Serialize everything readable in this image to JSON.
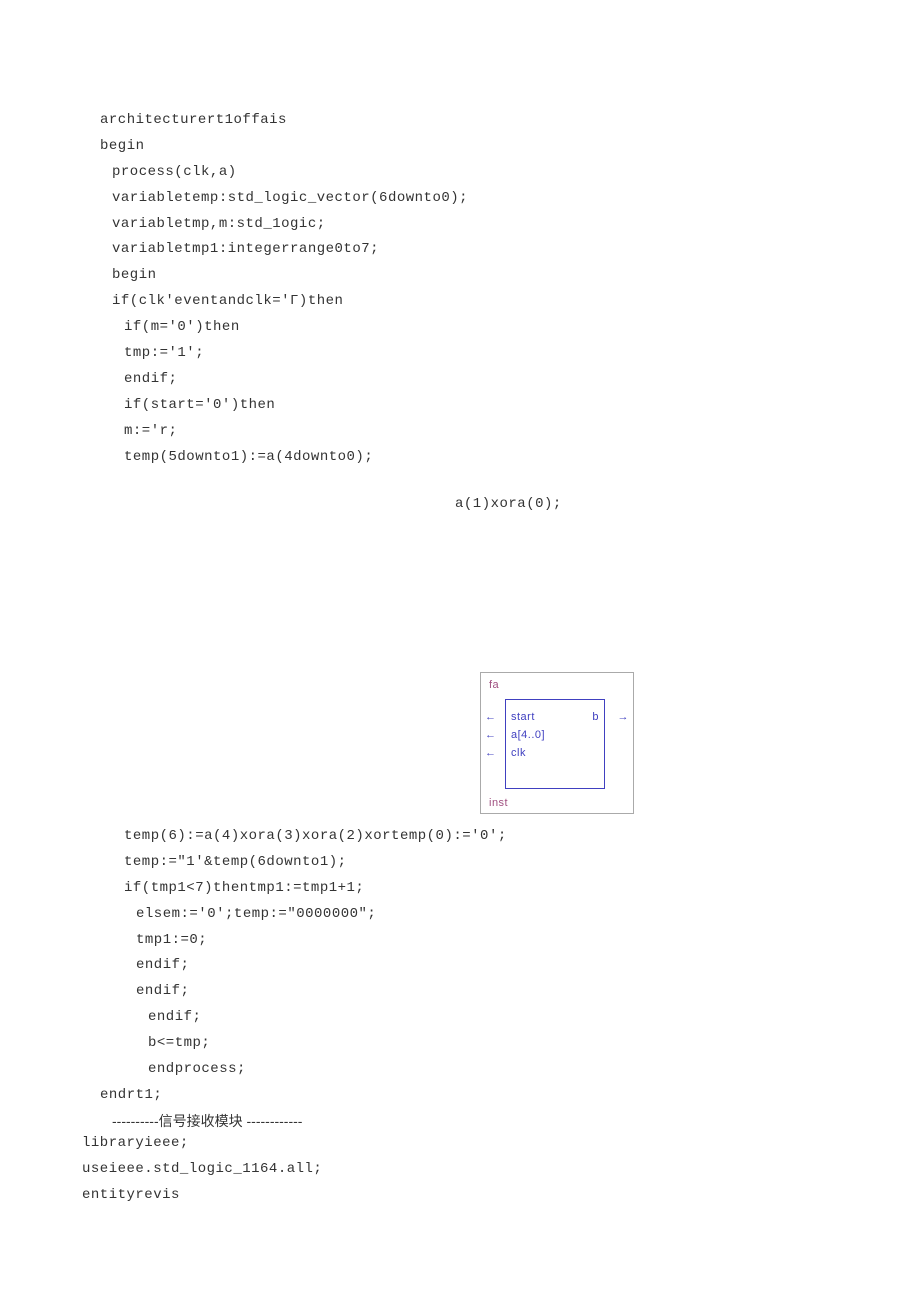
{
  "block_top": {
    "l1": "architecturert1offais",
    "l2": "begin",
    "l3": "process(clk,a)",
    "l4": "variabletemp:std_logic_vector(6downto0);",
    "l5": "variabletmp,m:std_1ogic;",
    "l6": "variabletmp1:integerrange0to7;",
    "l7": "begin",
    "l8": "if(clk'eventandclk='Γ)then",
    "l9": "if(m='0')then",
    "l10": "tmp:='1';",
    "l11": "endif;",
    "l12": "if(start='0')then",
    "l13": "m:='r;",
    "l14": "temp(5downto1):=a(4downto0);"
  },
  "mid_line": "a(1)xora(0);",
  "diagram": {
    "fa": "fa",
    "start": "start",
    "a": "a[4..0]",
    "clk": "clk",
    "b": "b",
    "inst": "inst"
  },
  "block_bottom": {
    "l1": "temp(6):=a(4)xora(3)xora(2)xortemp(0):='0';",
    "l2": "temp:=\"1'&temp(6downto1);",
    "l3": "if(tmp1<7)thentmp1:=tmp1+1;",
    "l4": "elsem:='0';temp:=\"0000000\";",
    "l5": "tmp1:=0;",
    "l6": "endif;",
    "l7": "endif;",
    "l8": "endif;",
    "l9": "b<=tmp;",
    "l10": "endprocess;",
    "l11": "endrt1;"
  },
  "separator": {
    "dashes_left": "----------",
    "label": "信号接收模块",
    "dashes_right": " ------------"
  },
  "block_footer": {
    "l1": "libraryieee;",
    "l2": "useieee.std_logic_1164.all;",
    "l3": "entityrevis"
  }
}
